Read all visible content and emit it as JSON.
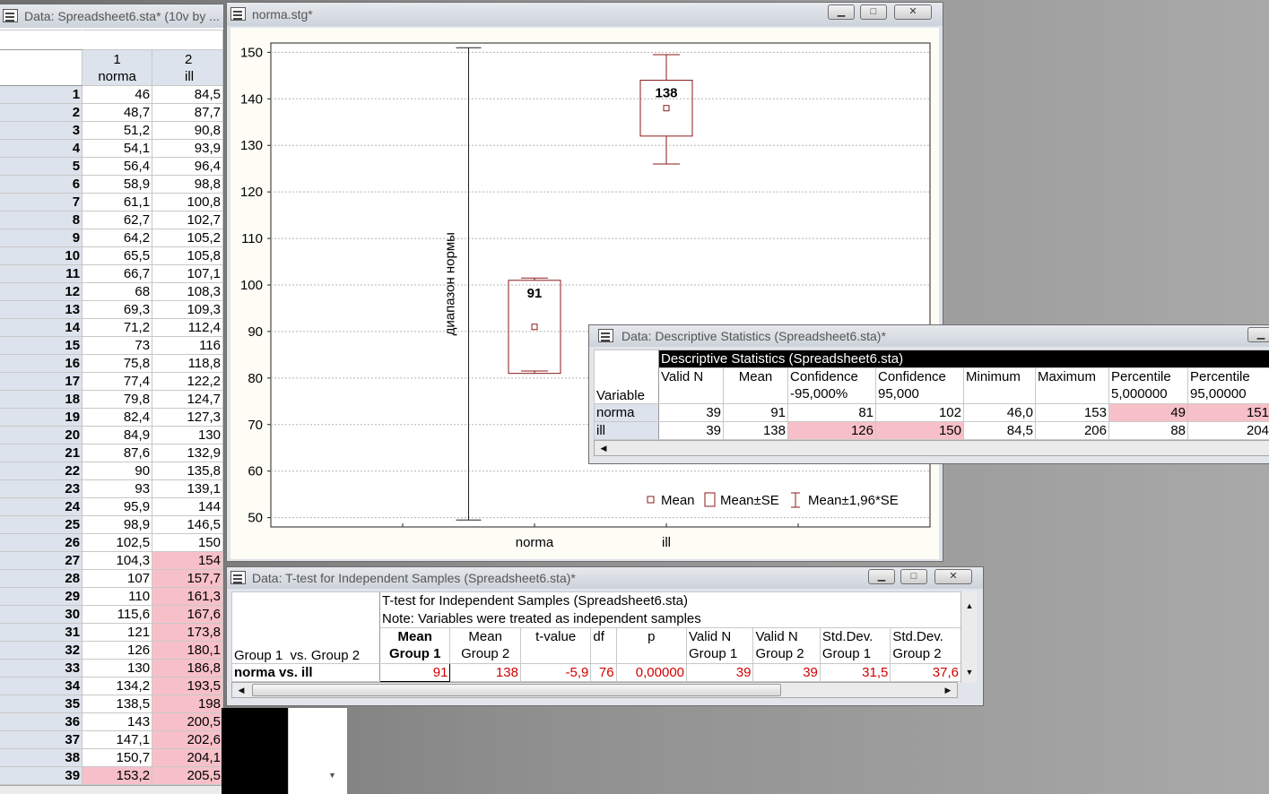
{
  "spreadsheet": {
    "title": "Data: Spreadsheet6.sta* (10v by ...",
    "col_nums": [
      "1",
      "2"
    ],
    "col_names": [
      "norma",
      "ill"
    ],
    "rows": [
      {
        "n": "1",
        "a": "46",
        "b": "84,5"
      },
      {
        "n": "2",
        "a": "48,7",
        "b": "87,7"
      },
      {
        "n": "3",
        "a": "51,2",
        "b": "90,8"
      },
      {
        "n": "4",
        "a": "54,1",
        "b": "93,9"
      },
      {
        "n": "5",
        "a": "56,4",
        "b": "96,4"
      },
      {
        "n": "6",
        "a": "58,9",
        "b": "98,8"
      },
      {
        "n": "7",
        "a": "61,1",
        "b": "100,8"
      },
      {
        "n": "8",
        "a": "62,7",
        "b": "102,7"
      },
      {
        "n": "9",
        "a": "64,2",
        "b": "105,2"
      },
      {
        "n": "10",
        "a": "65,5",
        "b": "105,8"
      },
      {
        "n": "11",
        "a": "66,7",
        "b": "107,1"
      },
      {
        "n": "12",
        "a": "68",
        "b": "108,3"
      },
      {
        "n": "13",
        "a": "69,3",
        "b": "109,3"
      },
      {
        "n": "14",
        "a": "71,2",
        "b": "112,4"
      },
      {
        "n": "15",
        "a": "73",
        "b": "116"
      },
      {
        "n": "16",
        "a": "75,8",
        "b": "118,8"
      },
      {
        "n": "17",
        "a": "77,4",
        "b": "122,2"
      },
      {
        "n": "18",
        "a": "79,8",
        "b": "124,7"
      },
      {
        "n": "19",
        "a": "82,4",
        "b": "127,3"
      },
      {
        "n": "20",
        "a": "84,9",
        "b": "130"
      },
      {
        "n": "21",
        "a": "87,6",
        "b": "132,9"
      },
      {
        "n": "22",
        "a": "90",
        "b": "135,8"
      },
      {
        "n": "23",
        "a": "93",
        "b": "139,1"
      },
      {
        "n": "24",
        "a": "95,9",
        "b": "144"
      },
      {
        "n": "25",
        "a": "98,9",
        "b": "146,5"
      },
      {
        "n": "26",
        "a": "102,5",
        "b": "150"
      },
      {
        "n": "27",
        "a": "104,3",
        "b": "154",
        "pb": true
      },
      {
        "n": "28",
        "a": "107",
        "b": "157,7",
        "pb": true
      },
      {
        "n": "29",
        "a": "110",
        "b": "161,3",
        "pb": true
      },
      {
        "n": "30",
        "a": "115,6",
        "b": "167,6",
        "pb": true
      },
      {
        "n": "31",
        "a": "121",
        "b": "173,8",
        "pb": true
      },
      {
        "n": "32",
        "a": "126",
        "b": "180,1",
        "pb": true
      },
      {
        "n": "33",
        "a": "130",
        "b": "186,8",
        "pb": true
      },
      {
        "n": "34",
        "a": "134,2",
        "b": "193,5",
        "pb": true
      },
      {
        "n": "35",
        "a": "138,5",
        "b": "198",
        "pb": true
      },
      {
        "n": "36",
        "a": "143",
        "b": "200,5",
        "pb": true
      },
      {
        "n": "37",
        "a": "147,1",
        "b": "202,6",
        "pb": true
      },
      {
        "n": "38",
        "a": "150,7",
        "b": "204,1",
        "pb": true
      },
      {
        "n": "39",
        "a": "153,2",
        "b": "205,5",
        "pa": true,
        "pb": true
      }
    ]
  },
  "graph_window": {
    "title": "norma.stg*"
  },
  "chart_data": {
    "type": "box",
    "categories": [
      "norma",
      "ill"
    ],
    "ylim": [
      48,
      152
    ],
    "yticks": [
      "50",
      "60",
      "70",
      "80",
      "90",
      "100",
      "110",
      "120",
      "130",
      "140",
      "150"
    ],
    "grid": true,
    "series": [
      {
        "category": "norma",
        "mean": 91,
        "mean_label": "91",
        "se_low": 81,
        "se_high": 101,
        "ci_low": 81.5,
        "ci_high": 101.5
      },
      {
        "category": "ill",
        "mean": 138,
        "mean_label": "138",
        "se_low": 132,
        "se_high": 144,
        "ci_low": 126,
        "ci_high": 149.5
      }
    ],
    "range_bar": {
      "label": "диапазон нормы",
      "low": 49.5,
      "high": 151
    },
    "legend": [
      "Mean",
      "Mean±SE",
      "Mean±1,96*SE"
    ],
    "legend_position": "bottom-right"
  },
  "descriptive": {
    "title": "Data: Descriptive Statistics (Spreadsheet6.sta)*",
    "caption": "Descriptive Statistics (Spreadsheet6.sta)",
    "variable_header": "Variable",
    "columns": [
      {
        "l1": "Valid N",
        "l2": ""
      },
      {
        "l1": "Mean",
        "l2": ""
      },
      {
        "l1": "Confidence",
        "l2": "-95,000%"
      },
      {
        "l1": "Confidence",
        "l2": "95,000"
      },
      {
        "l1": "Minimum",
        "l2": ""
      },
      {
        "l1": "Maximum",
        "l2": ""
      },
      {
        "l1": "Percentile",
        "l2": "5,000000"
      },
      {
        "l1": "Percentile",
        "l2": "95,00000"
      }
    ],
    "rows": [
      {
        "name": "norma",
        "cells": [
          "39",
          "91",
          "81",
          "102",
          "46,0",
          "153",
          "49",
          "151"
        ],
        "pink": [
          6,
          7
        ]
      },
      {
        "name": "ill",
        "cells": [
          "39",
          "138",
          "126",
          "150",
          "84,5",
          "206",
          "88",
          "204"
        ],
        "pink": [
          2,
          3
        ]
      }
    ]
  },
  "ttest": {
    "title": "Data: T-test for Independent Samples (Spreadsheet6.sta)*",
    "caption1": "T-test for Independent Samples (Spreadsheet6.sta)",
    "caption2": "Note: Variables were treated as independent samples",
    "group_header": "Group 1  vs. Group 2",
    "columns": [
      {
        "l1": "Mean",
        "l2": "Group 1",
        "bold": true
      },
      {
        "l1": "Mean",
        "l2": "Group 2"
      },
      {
        "l1": "t-value",
        "l2": ""
      },
      {
        "l1": "df",
        "l2": ""
      },
      {
        "l1": "p",
        "l2": ""
      },
      {
        "l1": "Valid N",
        "l2": "Group 1"
      },
      {
        "l1": "Valid N",
        "l2": "Group 2"
      },
      {
        "l1": "Std.Dev.",
        "l2": "Group 1"
      },
      {
        "l1": "Std.Dev.",
        "l2": "Group 2"
      }
    ],
    "row_name": "norma vs. ill",
    "row_cells": [
      "91",
      "138",
      "-5,9",
      "76",
      "0,00000",
      "39",
      "39",
      "31,5",
      "37,6"
    ]
  },
  "window_buttons": {
    "minimize": "▁",
    "maximize": "□",
    "close": "✕"
  }
}
